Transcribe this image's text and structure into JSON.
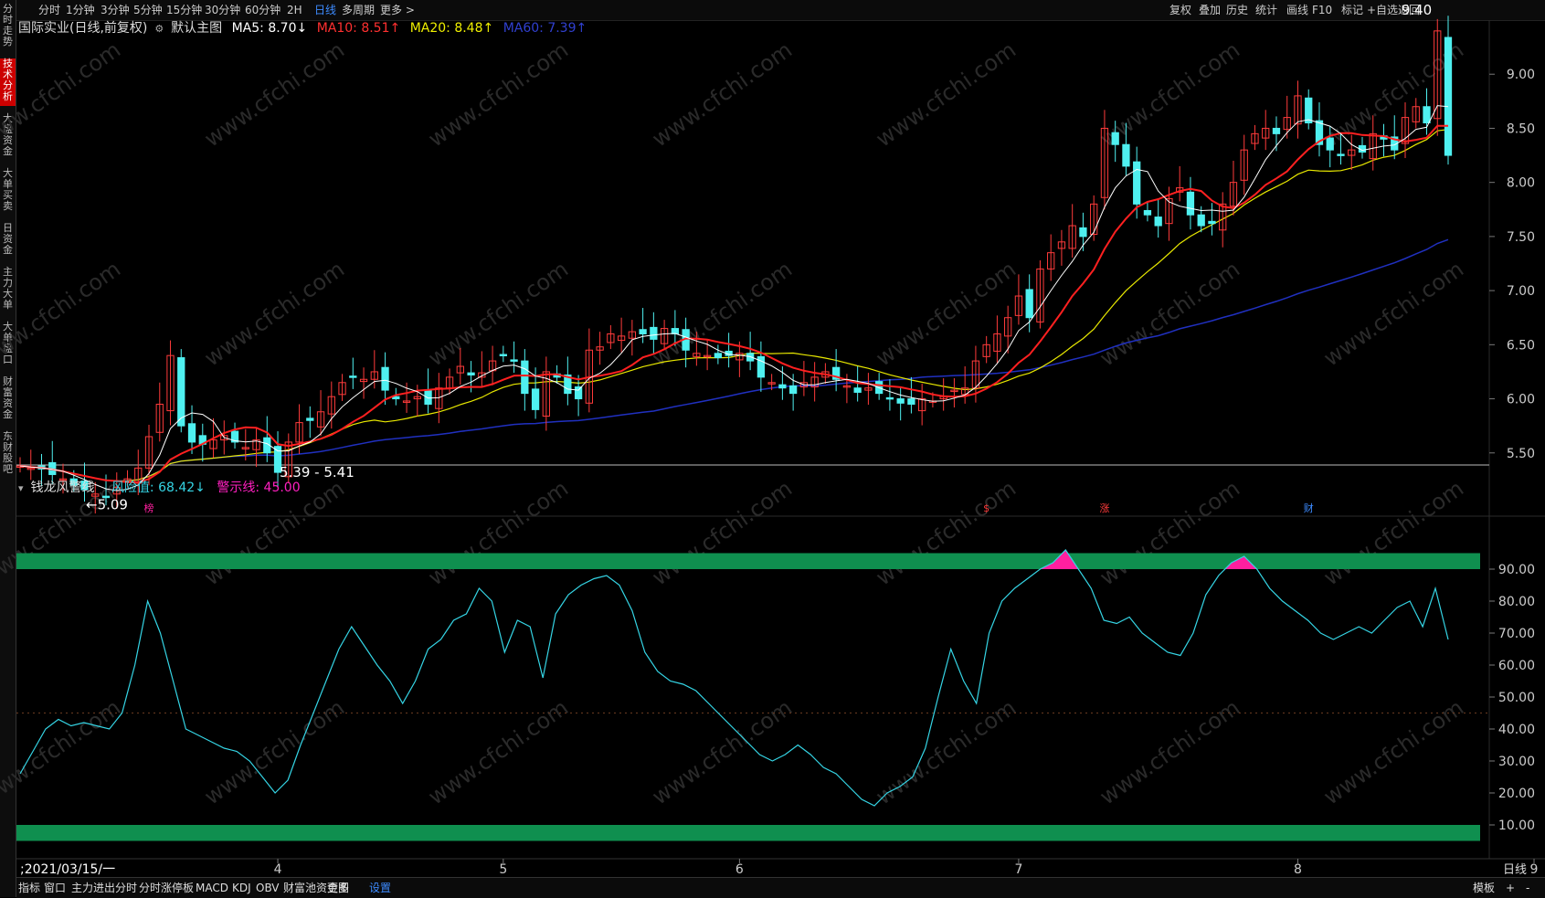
{
  "topbar": {
    "periods": [
      "分时",
      "1分钟",
      "3分钟",
      "5分钟",
      "15分钟",
      "30分钟",
      "60分钟",
      "2H",
      "日线",
      "多周期",
      "更多 >"
    ],
    "active_period": "日线",
    "right_tools": [
      "复权",
      "叠加",
      "历史",
      "统计",
      "画线",
      "F10",
      "标记",
      "+自选",
      "返回"
    ]
  },
  "left_nav": [
    "分时走势",
    "技术分析",
    "大盘资金",
    "大单买卖",
    "日资金",
    "主力大单",
    "大单盘口",
    "财富资金",
    "东财股吧"
  ],
  "left_nav_active": "技术分析",
  "main_legend": {
    "stock": "国际实业(日线,前复权)",
    "chart_name": "默认主图",
    "ma5": "MA5: 8.70↓",
    "ma10": "MA10: 8.51↑",
    "ma20": "MA20: 8.48↑",
    "ma60": "MA60: 7.39↑"
  },
  "indicator_legend": {
    "name": "钱龙风警线",
    "risk": "风险值: 68.42↓",
    "warn": "警示线: 45.00"
  },
  "annotations": {
    "high": "9.40",
    "low": "←5.09",
    "range": "5.39 - 5.41",
    "marker1": "榜",
    "marker2": "$",
    "marker3": "涨",
    "marker4": "财"
  },
  "x_axis": {
    "start": ";2021/03/15/一",
    "months": [
      "4",
      "5",
      "6",
      "7",
      "8",
      "9"
    ],
    "right": "日线"
  },
  "bottombar": [
    "指标",
    "窗口",
    "主力进出分时",
    "分时涨停板",
    "MACD",
    "KDJ",
    "OBV",
    "财富池资金图",
    "更多",
    "设置"
  ],
  "bottombar_active": "设置",
  "bottom_right": [
    "模板",
    "+",
    "-"
  ],
  "watermark": "www.cfchi.com",
  "colors": {
    "up": "#ff3b3b",
    "down": "#4ff0f0",
    "ma5": "#ffffff",
    "ma10": "#ff2020",
    "ma20": "#e8e800",
    "ma60": "#2030c0",
    "band": "#0f8f4f",
    "warn_fill": "#ff1f9f"
  },
  "chart_data": [
    {
      "type": "candlestick",
      "title": "国际实业(日线,前复权)",
      "y_ticks": [
        5.5,
        6.0,
        6.5,
        7.0,
        7.5,
        8.0,
        8.5,
        9.0
      ],
      "ylim": [
        5.0,
        9.5
      ],
      "close": [
        5.38,
        5.36,
        5.35,
        5.3,
        5.26,
        5.2,
        5.16,
        5.12,
        5.1,
        5.18,
        5.26,
        5.36,
        5.65,
        5.95,
        6.4,
        5.75,
        5.6,
        5.58,
        5.62,
        5.66,
        5.6,
        5.55,
        5.62,
        5.5,
        5.32,
        5.6,
        5.78,
        5.8,
        5.88,
        6.02,
        6.15,
        6.2,
        6.18,
        6.25,
        6.08,
        6.0,
        5.98,
        6.02,
        5.95,
        6.1,
        6.2,
        6.3,
        6.22,
        6.24,
        6.35,
        6.4,
        6.35,
        6.05,
        5.9,
        6.25,
        6.2,
        6.05,
        6.0,
        6.45,
        6.48,
        6.6,
        6.58,
        6.62,
        6.6,
        6.55,
        6.65,
        6.6,
        6.45,
        6.42,
        6.4,
        6.38,
        6.4,
        6.42,
        6.35,
        6.2,
        6.15,
        6.1,
        6.05,
        6.15,
        6.2,
        6.25,
        6.18,
        6.12,
        6.06,
        6.1,
        6.05,
        6.0,
        5.96,
        5.95,
        6.0,
        5.98,
        6.02,
        6.08,
        6.1,
        6.35,
        6.5,
        6.6,
        6.75,
        6.95,
        6.75,
        7.2,
        7.35,
        7.45,
        7.6,
        7.5,
        7.8,
        8.5,
        8.35,
        8.15,
        7.8,
        7.7,
        7.6,
        7.85,
        7.95,
        7.7,
        7.6,
        7.62,
        7.8,
        8.0,
        8.3,
        8.45,
        8.5,
        8.45,
        8.6,
        8.8,
        8.55,
        8.35,
        8.3,
        8.25,
        8.3,
        8.28,
        8.45,
        8.4,
        8.3,
        8.6,
        8.7,
        8.55,
        9.4,
        8.25
      ],
      "risk_value": [
        26,
        33,
        40,
        43,
        41,
        42,
        41,
        40,
        45,
        60,
        80,
        70,
        55,
        40,
        38,
        36,
        34,
        33,
        30,
        25,
        20,
        24,
        35,
        45,
        55,
        65,
        72,
        66,
        60,
        55,
        48,
        55,
        65,
        68,
        74,
        76,
        84,
        80,
        64,
        74,
        72,
        56,
        76,
        82,
        85,
        87,
        88,
        85,
        77,
        64,
        58,
        55,
        54,
        52,
        48,
        44,
        40,
        36,
        32,
        30,
        32,
        35,
        32,
        28,
        26,
        22,
        18,
        16,
        20,
        22,
        25,
        34,
        50,
        65,
        55,
        48,
        70,
        80,
        84,
        87,
        90,
        92,
        96,
        90,
        84,
        74,
        73,
        75,
        70,
        67,
        64,
        63,
        70,
        82,
        88,
        92,
        94,
        90,
        84,
        80,
        77,
        74,
        70,
        68,
        70,
        72,
        70,
        74,
        78,
        80,
        72,
        84,
        68
      ]
    }
  ]
}
